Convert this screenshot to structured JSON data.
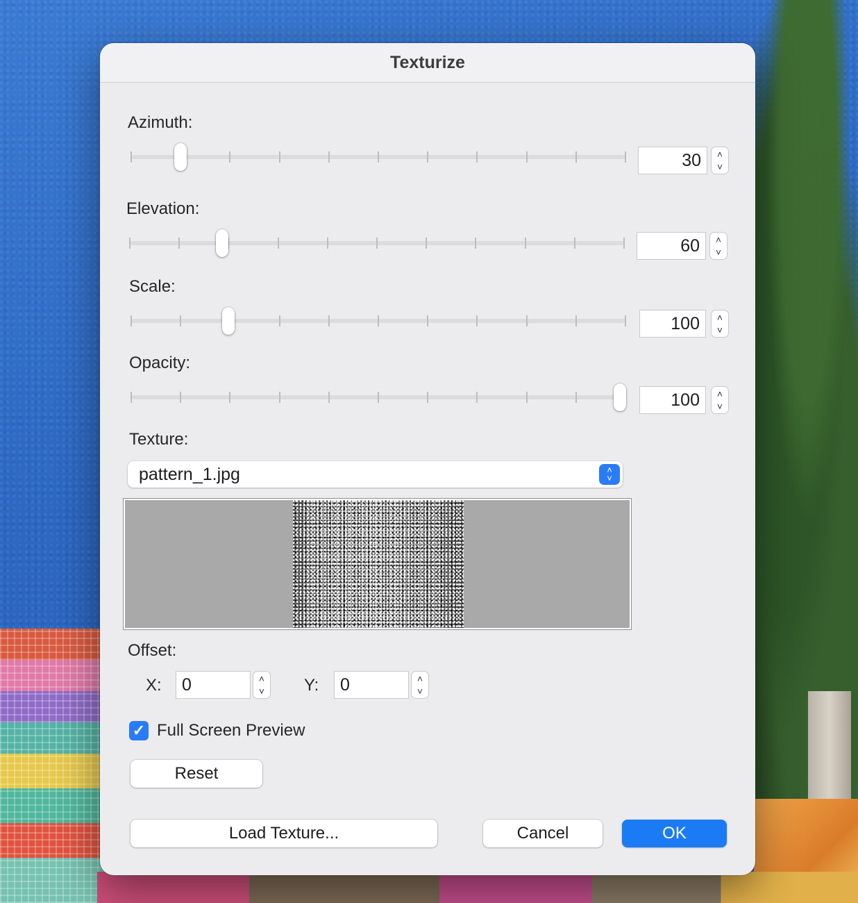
{
  "dialog": {
    "title": "Texturize",
    "azimuth": {
      "label": "Azimuth:",
      "value": "30",
      "slider_fraction": 0.09
    },
    "elevation": {
      "label": "Elevation:",
      "value": "60",
      "slider_fraction": 0.18
    },
    "scale": {
      "label": "Scale:",
      "value": "100",
      "slider_fraction": 0.19
    },
    "opacity": {
      "label": "Opacity:",
      "value": "100",
      "slider_fraction": 1.0
    },
    "texture": {
      "label": "Texture:",
      "selected": "pattern_1.jpg"
    },
    "offset": {
      "label": "Offset:",
      "x_label": "X:",
      "x_value": "0",
      "y_label": "Y:",
      "y_value": "0"
    },
    "full_screen_preview": {
      "label": "Full Screen Preview",
      "checked": true
    },
    "buttons": {
      "reset": "Reset",
      "load_texture": "Load Texture...",
      "cancel": "Cancel",
      "ok": "OK"
    }
  },
  "icons": {
    "stepper_up": "˄",
    "stepper_down": "˅",
    "checkmark": "✓"
  },
  "colors": {
    "accent": "#1a7bf5"
  }
}
